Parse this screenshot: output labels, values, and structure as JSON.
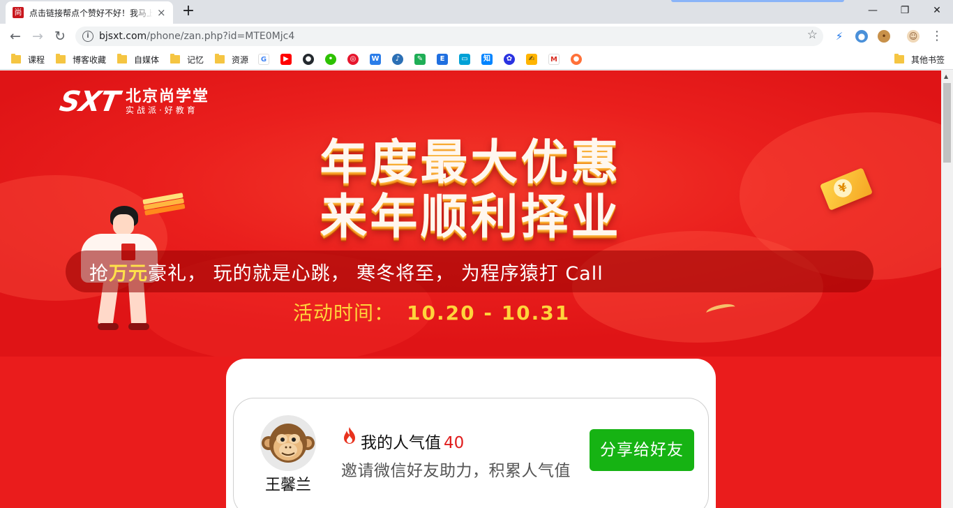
{
  "browser": {
    "tab": {
      "favicon_text": "尚",
      "title": "点击链接帮点个赞好不好！我马上",
      "close_glyph": "×"
    },
    "new_tab_glyph": "+",
    "window_controls": {
      "minimize": "—",
      "restore": "❐",
      "close": "✕"
    },
    "nav": {
      "back": "←",
      "forward": "→",
      "reload": "↻"
    },
    "address": {
      "host": "bjsxt.com",
      "path": "/phone/zan.php?id=MTE0Mjc4",
      "info_glyph": "i",
      "star_glyph": "☆"
    },
    "menu_glyph": "⋮"
  },
  "bookmarks": {
    "folders": [
      "课程",
      "博客收藏",
      "自媒体",
      "记忆",
      "资源"
    ],
    "other": "其他书签",
    "icon_names": [
      "google-icon",
      "youtube-icon",
      "github-icon",
      "wechat-icon",
      "weibo-icon",
      "w-icon",
      "douban-icon",
      "feather-icon",
      "e-icon",
      "bilibili-icon",
      "zhihu-icon",
      "baidu-icon",
      "pen-icon",
      "gmail-icon",
      "fox-icon"
    ]
  },
  "banner": {
    "brand_mark": "SXT",
    "brand_name": "北京尚学堂",
    "brand_slogan": "实战派·好教育",
    "headline_1": "年度最大优惠",
    "headline_2": "来年顺利择业",
    "tagline_pre": "抢",
    "tagline_hl": "万元",
    "tagline_post": "豪礼， 玩的就是心跳， 寒冬将至， 为程序猿打 Call",
    "period_label": "活动时间：",
    "period_dates": "10.20 - 10.31",
    "yen": "¥"
  },
  "card": {
    "username": "王馨兰",
    "popularity_label": "我的人气值",
    "popularity_value": "40",
    "invite_text": "邀请微信好友助力，积累人气值",
    "share_button": "分享给好友"
  },
  "colors": {
    "page_red": "#ea1c1c",
    "headline_gold": "#ffd43b",
    "share_green": "#16b313",
    "value_red": "#e01d1d"
  }
}
